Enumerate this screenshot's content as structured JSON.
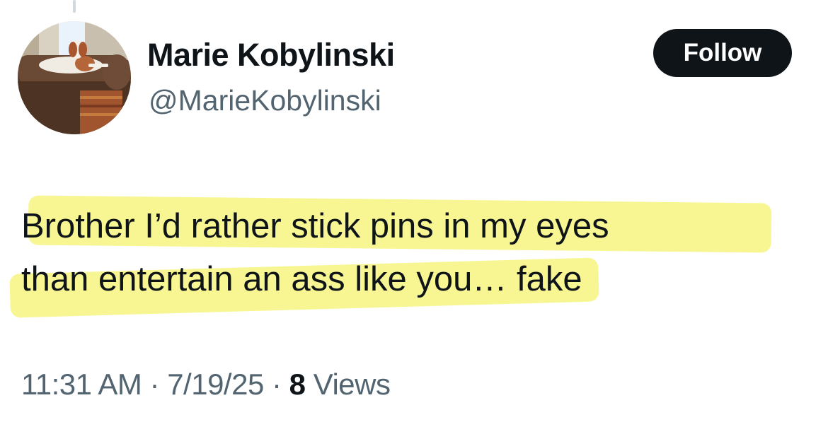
{
  "author": {
    "display_name": "Marie Kobylinski",
    "handle": "@MarieKobylinski"
  },
  "follow_button": {
    "label": "Follow"
  },
  "tweet": {
    "lines": [
      "Brother I’d rather stick pins in my eyes",
      "than entertain an ass like you… fake"
    ],
    "highlight_color": "#f8f58c"
  },
  "meta": {
    "time": "11:31 AM",
    "separator": "·",
    "date": "7/19/25",
    "views_count": "8",
    "views_label": "Views"
  },
  "colors": {
    "text_primary": "#0f1419",
    "text_secondary": "#536471",
    "button_bg": "#0f1419"
  }
}
